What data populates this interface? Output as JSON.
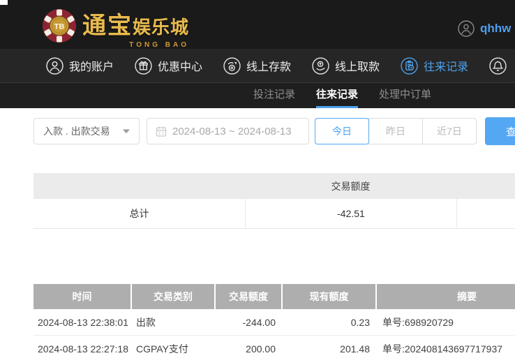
{
  "brand": {
    "chip_text": "TB",
    "name_main": "通宝",
    "name_sub": "娱乐城",
    "name_en": "TONG BAO"
  },
  "header": {
    "username": "qhhw"
  },
  "nav": {
    "items": [
      {
        "label": "我的账户"
      },
      {
        "label": "优惠中心"
      },
      {
        "label": "线上存款"
      },
      {
        "label": "线上取款"
      },
      {
        "label": "往来记录"
      }
    ]
  },
  "subnav": {
    "items": [
      {
        "label": "投注记录"
      },
      {
        "label": "往来记录"
      },
      {
        "label": "处理中订单"
      }
    ]
  },
  "filters": {
    "type_select_value": "入款 . 出款交易",
    "date_range_value": "2024-08-13 ~ 2024-08-13",
    "quick_buttons": [
      {
        "label": "今日"
      },
      {
        "label": "昨日"
      },
      {
        "label": "近7日"
      }
    ],
    "search_label": "查询"
  },
  "summary_table": {
    "header": "交易额度",
    "row_label": "总计",
    "total": "-42.51"
  },
  "transactions_table": {
    "columns": [
      "时间",
      "交易类别",
      "交易额度",
      "现有额度",
      "摘要"
    ],
    "rows": [
      {
        "time": "2024-08-13 22:38:01",
        "type": "出款",
        "amount": "-244.00",
        "balance": "0.23",
        "summary": "单号:698920729"
      },
      {
        "time": "2024-08-13 22:27:18",
        "type": "CGPAY支付",
        "amount": "200.00",
        "balance": "201.48",
        "summary": "单号:202408143697717937"
      }
    ]
  },
  "colors": {
    "accent_blue": "#4da3f0",
    "button_fill": "#54a7f2",
    "gold": "#e9ba4d",
    "table_header_bg": "#aeaeae",
    "summary_header_bg": "#ebebeb",
    "topbar_bg": "#1a1a1a"
  }
}
